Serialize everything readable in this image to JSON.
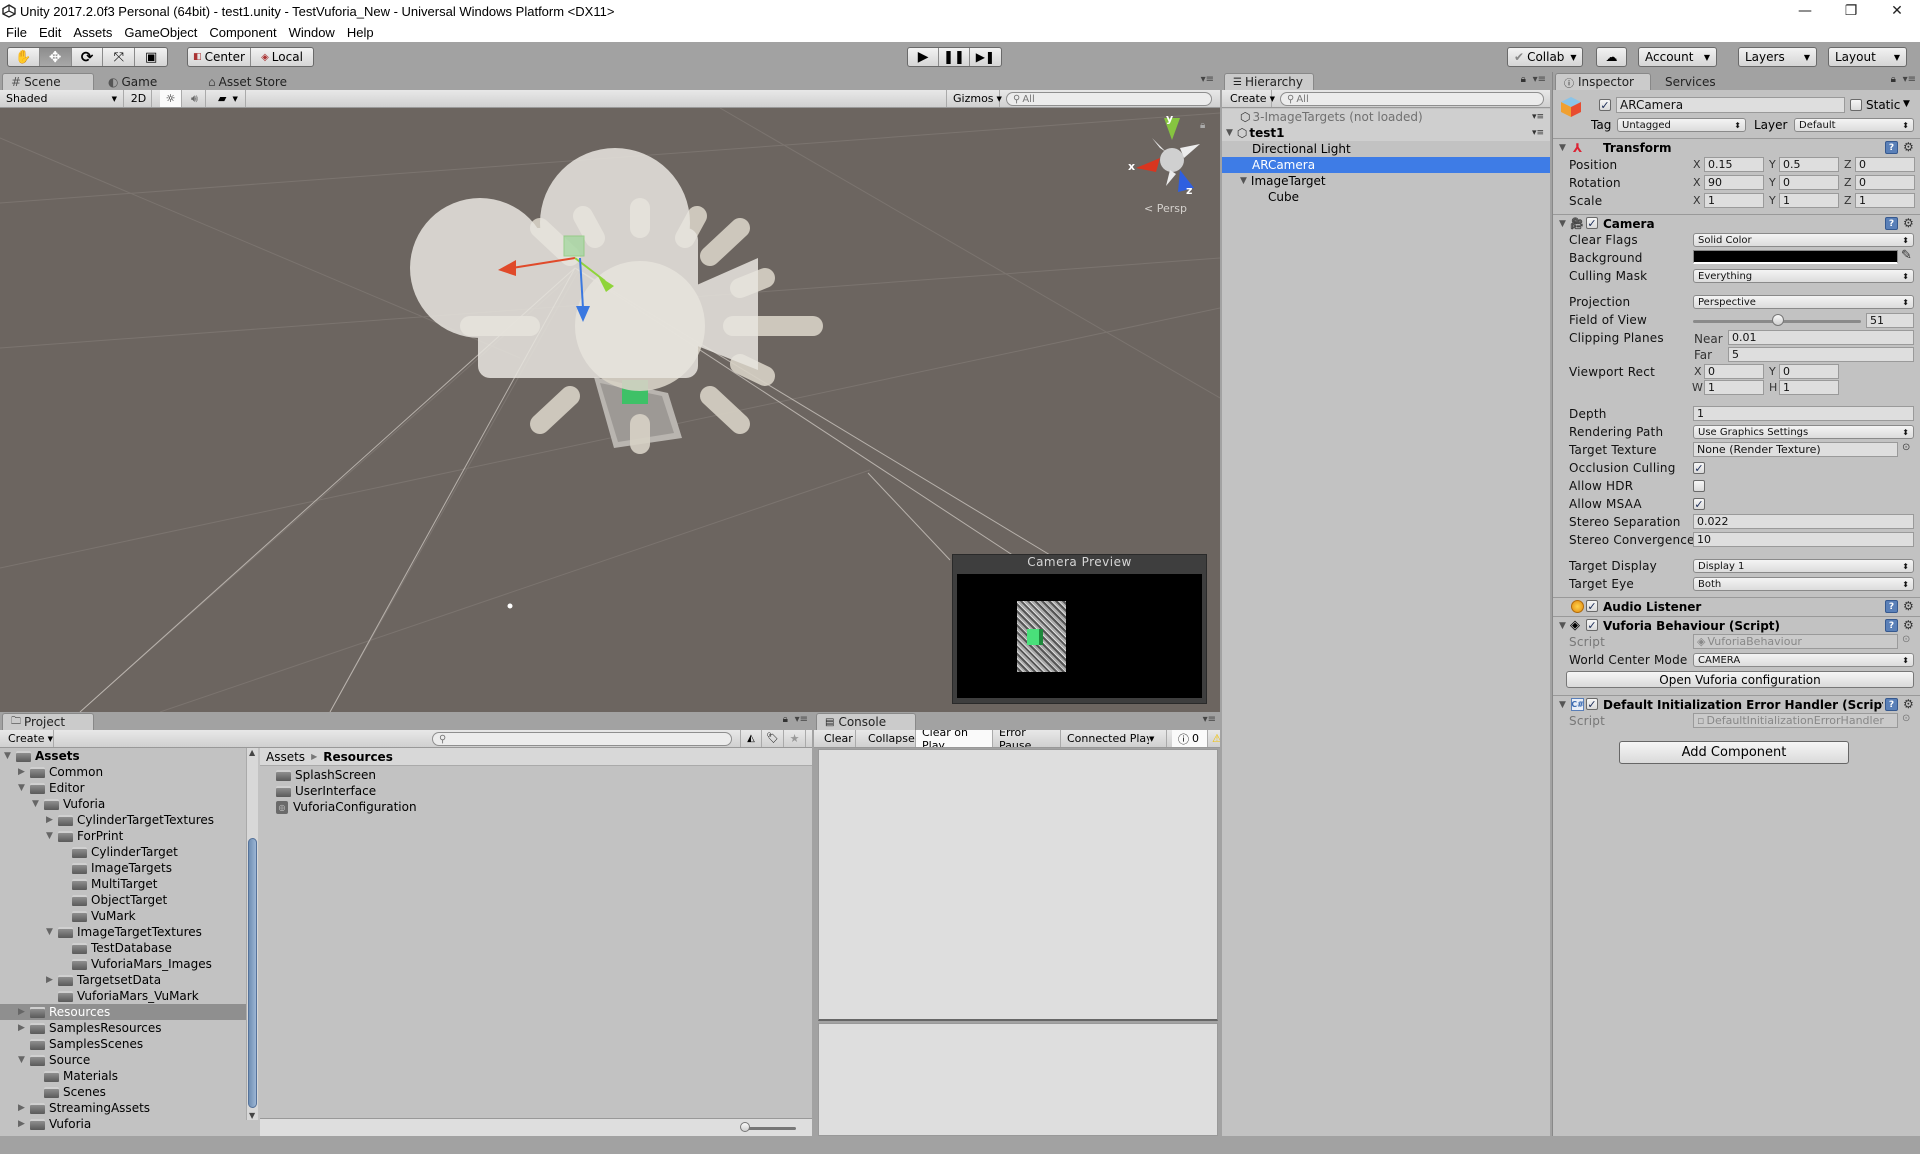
{
  "window": {
    "title": "Unity 2017.2.0f3 Personal (64bit) - test1.unity - TestVuforia_New - Universal Windows Platform <DX11>",
    "minimize_icon": "minimize-icon",
    "maximize_icon": "restore-icon",
    "close_icon": "close-icon"
  },
  "menu": [
    "File",
    "Edit",
    "Assets",
    "GameObject",
    "Component",
    "Window",
    "Help"
  ],
  "toolbar": {
    "tools": [
      {
        "name": "hand-tool",
        "icon": "hand-icon",
        "glyph": "✋"
      },
      {
        "name": "move-tool",
        "icon": "move-icon",
        "glyph": "✥",
        "active": true
      },
      {
        "name": "rotate-tool",
        "icon": "rotate-icon",
        "glyph": "⟳"
      },
      {
        "name": "scale-tool",
        "icon": "scale-icon",
        "glyph": "⤧"
      },
      {
        "name": "rect-tool",
        "icon": "rect-icon",
        "glyph": "▣"
      }
    ],
    "pivot": "Center",
    "space": "Local",
    "play_icon": "play-icon",
    "pause_icon": "pause-icon",
    "step_icon": "step-icon",
    "collab": "Collab",
    "account": "Account",
    "layers": "Layers",
    "layout": "Layout"
  },
  "scene": {
    "tabs": [
      "Scene",
      "Game",
      "Asset Store"
    ],
    "active_tab": "Scene",
    "shading": "Shaded",
    "mode_2d": "2D",
    "gizmos": "Gizmos",
    "search_placeholder": "All",
    "persp_label": "Persp",
    "axis_labels": {
      "x": "x",
      "y": "y",
      "z": "z"
    },
    "camera_preview_title": "Camera Preview"
  },
  "hierarchy": {
    "tab": "Hierarchy",
    "create": "Create",
    "search_placeholder": "All",
    "items": [
      {
        "label": "3-ImageTargets (not loaded)",
        "type": "scene",
        "depth": 0,
        "unloaded": true
      },
      {
        "label": "test1",
        "type": "scene",
        "depth": 0,
        "expanded": true
      },
      {
        "label": "Directional Light",
        "depth": 1
      },
      {
        "label": "ARCamera",
        "depth": 1,
        "selected": true
      },
      {
        "label": "ImageTarget",
        "depth": 1,
        "expanded": true
      },
      {
        "label": "Cube",
        "depth": 2
      }
    ]
  },
  "inspector": {
    "tabs": [
      "Inspector",
      "Services"
    ],
    "object_name": "ARCamera",
    "active": true,
    "static_label": "Static",
    "tag_label": "Tag",
    "tag_value": "Untagged",
    "layer_label": "Layer",
    "layer_value": "Default",
    "transform": {
      "title": "Transform",
      "position": {
        "label": "Position",
        "x": "0.15",
        "y": "0.5",
        "z": "0"
      },
      "rotation": {
        "label": "Rotation",
        "x": "90",
        "y": "0",
        "z": "0"
      },
      "scale": {
        "label": "Scale",
        "x": "1",
        "y": "1",
        "z": "1"
      }
    },
    "camera": {
      "title": "Camera",
      "enabled": true,
      "clear_flags": {
        "label": "Clear Flags",
        "value": "Solid Color"
      },
      "background": {
        "label": "Background",
        "color": "#000000"
      },
      "culling_mask": {
        "label": "Culling Mask",
        "value": "Everything"
      },
      "projection": {
        "label": "Projection",
        "value": "Perspective"
      },
      "fov": {
        "label": "Field of View",
        "value": "51",
        "min": 1,
        "max": 179
      },
      "clipping": {
        "label": "Clipping Planes",
        "near_label": "Near",
        "near": "0.01",
        "far_label": "Far",
        "far": "5"
      },
      "viewport": {
        "label": "Viewport Rect",
        "x": "0",
        "y": "0",
        "w": "1",
        "h": "1"
      },
      "depth": {
        "label": "Depth",
        "value": "1"
      },
      "rendering_path": {
        "label": "Rendering Path",
        "value": "Use Graphics Settings"
      },
      "target_texture": {
        "label": "Target Texture",
        "value": "None (Render Texture)"
      },
      "occlusion_culling": {
        "label": "Occlusion Culling",
        "checked": true
      },
      "allow_hdr": {
        "label": "Allow HDR",
        "checked": false
      },
      "allow_msaa": {
        "label": "Allow MSAA",
        "checked": true
      },
      "stereo_separation": {
        "label": "Stereo Separation",
        "value": "0.022"
      },
      "stereo_convergence": {
        "label": "Stereo Convergence",
        "value": "10"
      },
      "target_display": {
        "label": "Target Display",
        "value": "Display 1"
      },
      "target_eye": {
        "label": "Target Eye",
        "value": "Both"
      }
    },
    "audio_listener": {
      "title": "Audio Listener",
      "enabled": true
    },
    "vuforia_behaviour": {
      "title": "Vuforia Behaviour (Script)",
      "enabled": true,
      "script_label": "Script",
      "script_value": "VuforiaBehaviour",
      "world_center_label": "World Center Mode",
      "world_center_value": "CAMERA",
      "open_config": "Open Vuforia configuration"
    },
    "error_handler": {
      "title": "Default Initialization Error Handler (Script)",
      "enabled": true,
      "script_label": "Script",
      "script_value": "DefaultInitializationErrorHandler"
    },
    "add_component": "Add Component"
  },
  "project": {
    "tab": "Project",
    "create": "Create",
    "tree": [
      {
        "label": "Assets",
        "depth": 0,
        "arrow": "open",
        "bold": true
      },
      {
        "label": "Common",
        "depth": 1,
        "arrow": "closed"
      },
      {
        "label": "Editor",
        "depth": 1,
        "arrow": "open"
      },
      {
        "label": "Vuforia",
        "depth": 2,
        "arrow": "open"
      },
      {
        "label": "CylinderTargetTextures",
        "depth": 3,
        "arrow": "closed"
      },
      {
        "label": "ForPrint",
        "depth": 3,
        "arrow": "open"
      },
      {
        "label": "CylinderTarget",
        "depth": 4,
        "arrow": "none"
      },
      {
        "label": "ImageTargets",
        "depth": 4,
        "arrow": "none"
      },
      {
        "label": "MultiTarget",
        "depth": 4,
        "arrow": "none"
      },
      {
        "label": "ObjectTarget",
        "depth": 4,
        "arrow": "none"
      },
      {
        "label": "VuMark",
        "depth": 4,
        "arrow": "none"
      },
      {
        "label": "ImageTargetTextures",
        "depth": 3,
        "arrow": "open"
      },
      {
        "label": "TestDatabase",
        "depth": 4,
        "arrow": "none"
      },
      {
        "label": "VuforiaMars_Images",
        "depth": 4,
        "arrow": "none"
      },
      {
        "label": "TargetsetData",
        "depth": 3,
        "arrow": "closed"
      },
      {
        "label": "VuforiaMars_VuMark",
        "depth": 3,
        "arrow": "none"
      },
      {
        "label": "Resources",
        "depth": 1,
        "arrow": "closed",
        "selected": true
      },
      {
        "label": "SamplesResources",
        "depth": 1,
        "arrow": "closed"
      },
      {
        "label": "SamplesScenes",
        "depth": 1,
        "arrow": "none"
      },
      {
        "label": "Source",
        "depth": 1,
        "arrow": "open"
      },
      {
        "label": "Materials",
        "depth": 2,
        "arrow": "none"
      },
      {
        "label": "Scenes",
        "depth": 2,
        "arrow": "none"
      },
      {
        "label": "StreamingAssets",
        "depth": 1,
        "arrow": "closed"
      },
      {
        "label": "Vuforia",
        "depth": 1,
        "arrow": "closed"
      }
    ],
    "breadcrumb": [
      "Assets",
      "Resources"
    ],
    "files": [
      {
        "label": "SplashScreen",
        "icon": "folder-icon"
      },
      {
        "label": "UserInterface",
        "icon": "folder-icon"
      },
      {
        "label": "VuforiaConfiguration",
        "icon": "unity-asset-icon"
      }
    ],
    "zoom_slider": 0
  },
  "console": {
    "tab": "Console",
    "buttons": [
      "Clear",
      "Collapse",
      "Clear on Play",
      "Error Pause",
      "Connected Player"
    ],
    "active_buttons": [
      "Clear on Play"
    ],
    "info_count": "0"
  }
}
